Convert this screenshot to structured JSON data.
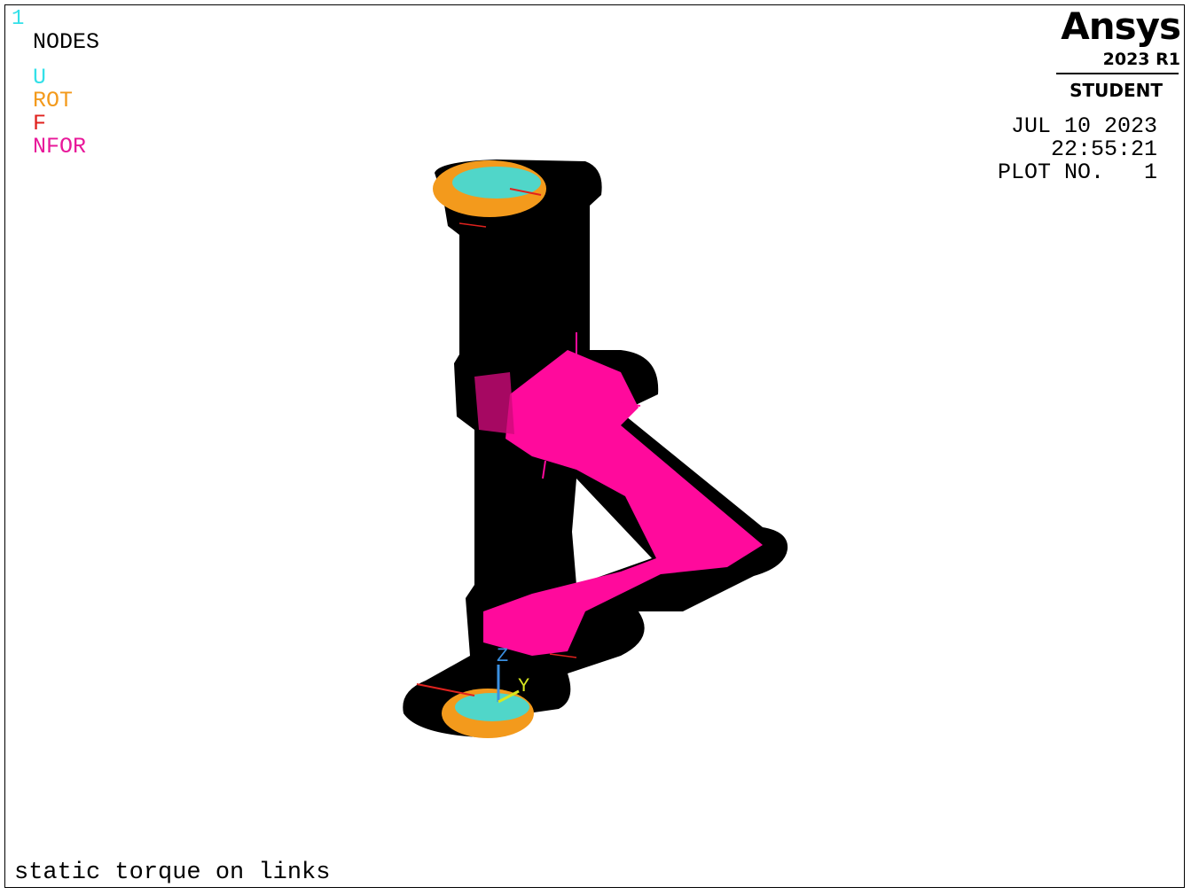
{
  "window": {
    "number": "1"
  },
  "legend": {
    "title": "NODES",
    "items": [
      {
        "label": "U",
        "color": "#33e0e8"
      },
      {
        "label": "ROT",
        "color": "#f39a1c"
      },
      {
        "label": "F",
        "color": "#e0221e"
      },
      {
        "label": "NFOR",
        "color": "#e8189a"
      }
    ]
  },
  "branding": {
    "name": "Ansys",
    "version": "2023 R1",
    "license": "STUDENT"
  },
  "info": {
    "date": "JUL 10 2023",
    "time": "22:55:21",
    "plot_label": "PLOT NO.",
    "plot_number": "1"
  },
  "triad": {
    "z": "Z",
    "y": "Y"
  },
  "plot_title": "static torque on links",
  "colors": {
    "model": "#000000",
    "displacement": "#33e0e8",
    "rotation": "#f39a1c",
    "force": "#e0221e",
    "nodal_force": "#ff0a9c",
    "triad_z": "#3a8fe0",
    "triad_y": "#d8e820"
  }
}
